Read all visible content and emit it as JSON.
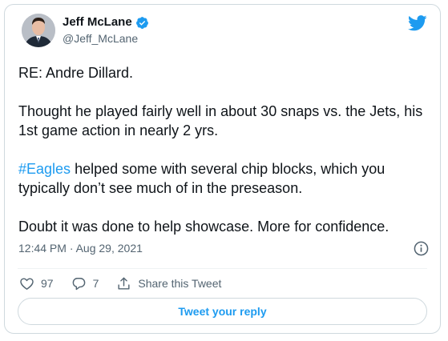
{
  "author": {
    "display_name": "Jeff McLane",
    "handle": "@Jeff_McLane",
    "verified": true
  },
  "tweet": {
    "paragraphs": [
      {
        "text": "RE: Andre Dillard."
      },
      {
        "text": "Thought he played fairly well in about 30 snaps vs. the Jets, his 1st game action in nearly 2 yrs."
      },
      {
        "hashtag": "#Eagles",
        "text": " helped some with several chip blocks, which you typically don’t see much of in the preseason."
      },
      {
        "text": "Doubt it was done to help showcase. More for confidence."
      }
    ],
    "timestamp": "12:44 PM · Aug 29, 2021"
  },
  "actions": {
    "like_count": "97",
    "reply_count": "7",
    "share_label": "Share this Tweet"
  },
  "reply_button_label": "Tweet your reply",
  "colors": {
    "accent": "#1d9bf0",
    "like": "#f91880",
    "text": "#0f1419",
    "secondary_text": "#536471",
    "border": "#cfd9de"
  },
  "icons": {
    "brand": "twitter-bird-icon",
    "verified": "verified-badge-icon",
    "info": "info-icon",
    "like": "heart-icon",
    "reply": "reply-icon",
    "share": "share-icon"
  }
}
